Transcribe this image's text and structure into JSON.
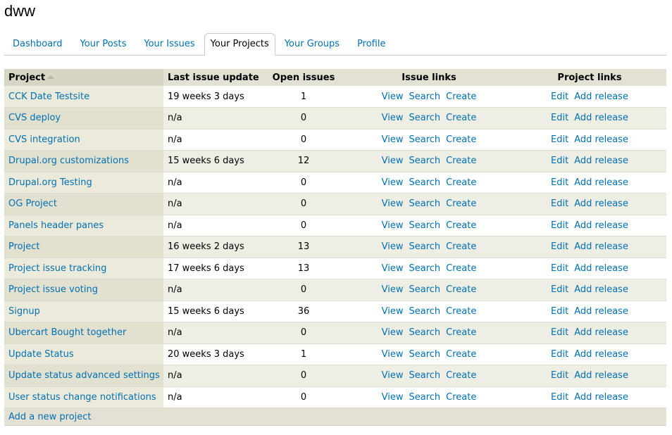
{
  "page": {
    "title": "dww"
  },
  "tabs": [
    {
      "label": "Dashboard"
    },
    {
      "label": "Your Posts"
    },
    {
      "label": "Your Issues"
    },
    {
      "label": "Your Projects",
      "active": true
    },
    {
      "label": "Your Groups"
    },
    {
      "label": "Profile"
    }
  ],
  "table": {
    "headers": {
      "project": "Project",
      "last_update": "Last issue update",
      "open_issues": "Open issues",
      "issue_links": "Issue links",
      "project_links": "Project links"
    },
    "link_labels": {
      "view": "View",
      "search": "Search",
      "create": "Create",
      "edit": "Edit",
      "add_release": "Add release"
    },
    "rows": [
      {
        "project": "CCK Date Testsite",
        "last_update": "19 weeks 3 days",
        "open_issues": "1"
      },
      {
        "project": "CVS deploy",
        "last_update": "n/a",
        "open_issues": "0"
      },
      {
        "project": "CVS integration",
        "last_update": "n/a",
        "open_issues": "0"
      },
      {
        "project": "Drupal.org customizations",
        "last_update": "15 weeks 6 days",
        "open_issues": "12"
      },
      {
        "project": "Drupal.org Testing",
        "last_update": "n/a",
        "open_issues": "0"
      },
      {
        "project": "OG Project",
        "last_update": "n/a",
        "open_issues": "0"
      },
      {
        "project": "Panels header panes",
        "last_update": "n/a",
        "open_issues": "0"
      },
      {
        "project": "Project",
        "last_update": "16 weeks 2 days",
        "open_issues": "13"
      },
      {
        "project": "Project issue tracking",
        "last_update": "17 weeks 6 days",
        "open_issues": "13"
      },
      {
        "project": "Project issue voting",
        "last_update": "n/a",
        "open_issues": "0"
      },
      {
        "project": "Signup",
        "last_update": "15 weeks 6 days",
        "open_issues": "36"
      },
      {
        "project": "Ubercart Bought together",
        "last_update": "n/a",
        "open_issues": "0"
      },
      {
        "project": "Update Status",
        "last_update": "20 weeks 3 days",
        "open_issues": "1"
      },
      {
        "project": "Update status advanced settings",
        "last_update": "n/a",
        "open_issues": "0"
      },
      {
        "project": "User status change notifications",
        "last_update": "n/a",
        "open_issues": "0"
      }
    ],
    "footer_link": "Add a new project"
  },
  "colors": {
    "link": "#0070b3",
    "header_bg": "#e2e1d3",
    "row_alt_bg": "#eeeee4"
  }
}
